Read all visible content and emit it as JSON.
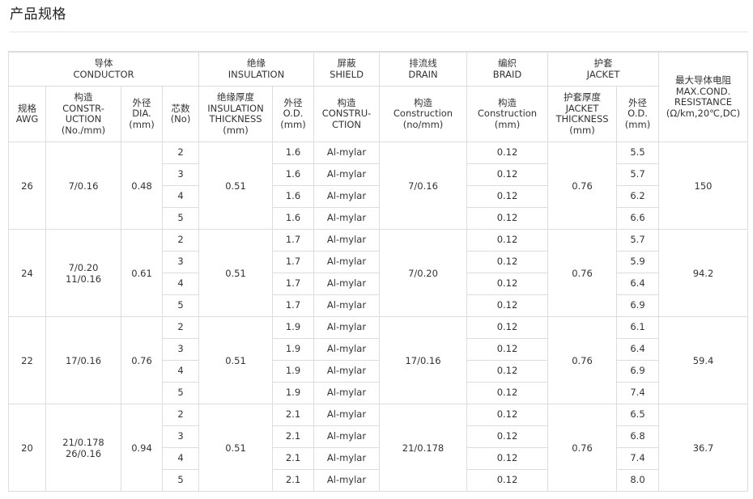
{
  "page_title": "产品规格",
  "header_groups": [
    {
      "zh": "导体",
      "en": "CONDUCTOR"
    },
    {
      "zh": "绝缘",
      "en": "INSULATION"
    },
    {
      "zh": "屏蔽",
      "en": "SHIELD"
    },
    {
      "zh": "排流线",
      "en": "DRAIN"
    },
    {
      "zh": "编织",
      "en": "BRAID"
    },
    {
      "zh": "护套",
      "en": "JACKET"
    }
  ],
  "resistance_header": "最大导体电阻\nMAX.COND.\nRESISTANCE\n(Ω/km,20℃,DC)",
  "sub_headers": [
    "规格\nAWG",
    "构造\nCONSTR-\nUCTION\n(No./mm)",
    "外径\nDIA.\n(mm)",
    "芯数\n(No)",
    "绝缘厚度\nINSULATION\nTHICKNESS\n(mm)",
    "外径\nO.D.\n(mm)",
    "构造\nCONSTRU-\nCTION",
    "构造\nConstruction\n(no/mm)",
    "构造\nConstruction\n(mm)",
    "护套厚度\nJACKET\nTHICKNESS\n(mm)",
    "外径\nO.D.\n(mm)"
  ],
  "groups": [
    {
      "awg": "26",
      "construction": "7/0.16",
      "dia": "0.48",
      "ins_thickness": "0.51",
      "drain": "7/0.16",
      "jacket_thickness": "0.76",
      "resistance": "150",
      "rows": [
        {
          "cores": "2",
          "ins_od": "1.6",
          "shield": "Al-mylar",
          "braid": "0.12",
          "jacket_od": "5.5"
        },
        {
          "cores": "3",
          "ins_od": "1.6",
          "shield": "Al-mylar",
          "braid": "0.12",
          "jacket_od": "5.7"
        },
        {
          "cores": "4",
          "ins_od": "1.6",
          "shield": "Al-mylar",
          "braid": "0.12",
          "jacket_od": "6.2"
        },
        {
          "cores": "5",
          "ins_od": "1.6",
          "shield": "Al-mylar",
          "braid": "0.12",
          "jacket_od": "6.6"
        }
      ]
    },
    {
      "awg": "24",
      "construction": "7/0.20\n11/0.16",
      "dia": "0.61",
      "ins_thickness": "0.51",
      "drain": "7/0.20",
      "jacket_thickness": "0.76",
      "resistance": "94.2",
      "rows": [
        {
          "cores": "2",
          "ins_od": "1.7",
          "shield": "Al-mylar",
          "braid": "0.12",
          "jacket_od": "5.7"
        },
        {
          "cores": "3",
          "ins_od": "1.7",
          "shield": "Al-mylar",
          "braid": "0.12",
          "jacket_od": "5.9"
        },
        {
          "cores": "4",
          "ins_od": "1.7",
          "shield": "Al-mylar",
          "braid": "0.12",
          "jacket_od": "6.4"
        },
        {
          "cores": "5",
          "ins_od": "1.7",
          "shield": "Al-mylar",
          "braid": "0.12",
          "jacket_od": "6.9"
        }
      ]
    },
    {
      "awg": "22",
      "construction": "17/0.16",
      "dia": "0.76",
      "ins_thickness": "0.51",
      "drain": "17/0.16",
      "jacket_thickness": "0.76",
      "resistance": "59.4",
      "rows": [
        {
          "cores": "2",
          "ins_od": "1.9",
          "shield": "Al-mylar",
          "braid": "0.12",
          "jacket_od": "6.1"
        },
        {
          "cores": "3",
          "ins_od": "1.9",
          "shield": "Al-mylar",
          "braid": "0.12",
          "jacket_od": "6.4"
        },
        {
          "cores": "4",
          "ins_od": "1.9",
          "shield": "Al-mylar",
          "braid": "0.12",
          "jacket_od": "6.9"
        },
        {
          "cores": "5",
          "ins_od": "1.9",
          "shield": "Al-mylar",
          "braid": "0.12",
          "jacket_od": "7.4"
        }
      ]
    },
    {
      "awg": "20",
      "construction": "21/0.178\n26/0.16",
      "dia": "0.94",
      "ins_thickness": "0.51",
      "drain": "21/0.178",
      "jacket_thickness": "0.76",
      "resistance": "36.7",
      "rows": [
        {
          "cores": "2",
          "ins_od": "2.1",
          "shield": "Al-mylar",
          "braid": "0.12",
          "jacket_od": "6.5"
        },
        {
          "cores": "3",
          "ins_od": "2.1",
          "shield": "Al-mylar",
          "braid": "0.12",
          "jacket_od": "6.8"
        },
        {
          "cores": "4",
          "ins_od": "2.1",
          "shield": "Al-mylar",
          "braid": "0.12",
          "jacket_od": "7.4"
        },
        {
          "cores": "5",
          "ins_od": "2.1",
          "shield": "Al-mylar",
          "braid": "0.12",
          "jacket_od": "8.0"
        }
      ]
    }
  ]
}
